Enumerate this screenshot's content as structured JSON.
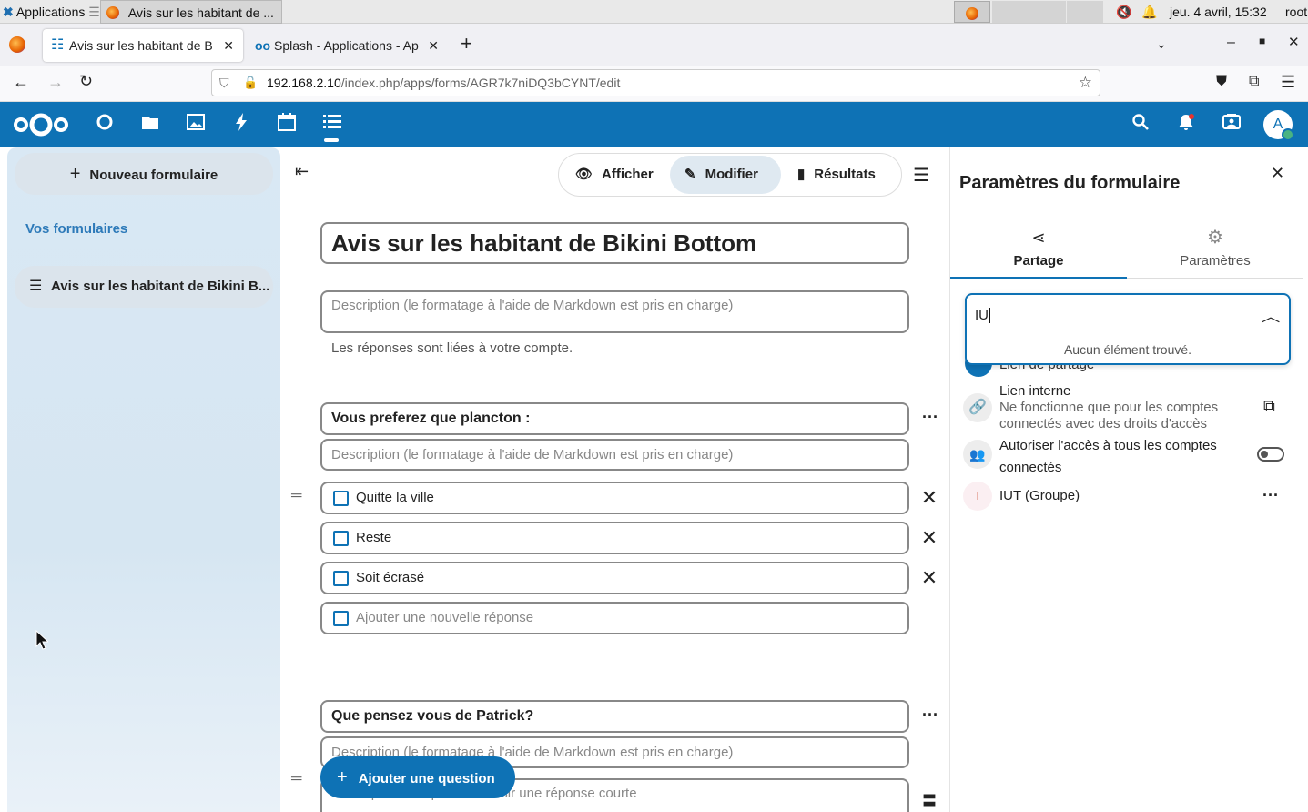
{
  "system": {
    "apps_label": "Applications",
    "window_title": "Avis sur les habitant de ...",
    "clock": "jeu. 4 avril, 15:32",
    "user": "root"
  },
  "browser": {
    "tabs": [
      {
        "title": "Avis sur les habitant de B"
      },
      {
        "title": "Splash - Applications - Ap"
      }
    ],
    "url_host": "192.168.2.10",
    "url_path": "/index.php/apps/forms/AGR7k7niDQ3bCYNT/edit"
  },
  "header": {
    "avatar_letter": "A",
    "accent": "#0e72b5"
  },
  "leftnav": {
    "new_form_label": "Nouveau formulaire",
    "section_title": "Vos formulaires",
    "forms": [
      "Avis sur les habitant de Bikini B..."
    ]
  },
  "toolbar": {
    "view_label": "Afficher",
    "edit_label": "Modifier",
    "results_label": "Résultats"
  },
  "form": {
    "title": "Avis sur les habitant de Bikini Bottom",
    "description_placeholder": "Description (le formatage à l'aide de Markdown est pris en charge)",
    "account_note": "Les réponses sont liées à votre compte.",
    "questions": [
      {
        "title": "Vous preferez que plancton :",
        "description_placeholder": "Description (le formatage à l'aide de Markdown est pris en charge)",
        "answers": [
          "Quitte la ville",
          "Reste",
          "Soit écrasé"
        ],
        "new_answer_placeholder": "Ajouter une nouvelle réponse"
      },
      {
        "title": "Que pensez vous de Patrick?",
        "description_placeholder": "Description (le formatage à l'aide de Markdown est pris en charge)",
        "short_answer_placeholder": "Les répondants peuvent saisir une réponse courte"
      }
    ],
    "add_question_label": "Ajouter une question"
  },
  "sidebar": {
    "title": "Paramètres du formulaire",
    "tabs": [
      "Partage",
      "Paramètres"
    ],
    "search_value": "IU",
    "no_results": "Aucun élément trouvé.",
    "share_link_label": "Lien de partage",
    "internal_link_title": "Lien interne",
    "internal_link_desc_1": "Ne fonctionne que pour les comptes",
    "internal_link_desc_2": "connectés avec des droits d'accès",
    "allow_all_1": "Autoriser l'accès à tous les comptes",
    "allow_all_2": "connectés",
    "allow_all_enabled": false,
    "group_initial": "I",
    "group_label": "IUT (Groupe)"
  }
}
